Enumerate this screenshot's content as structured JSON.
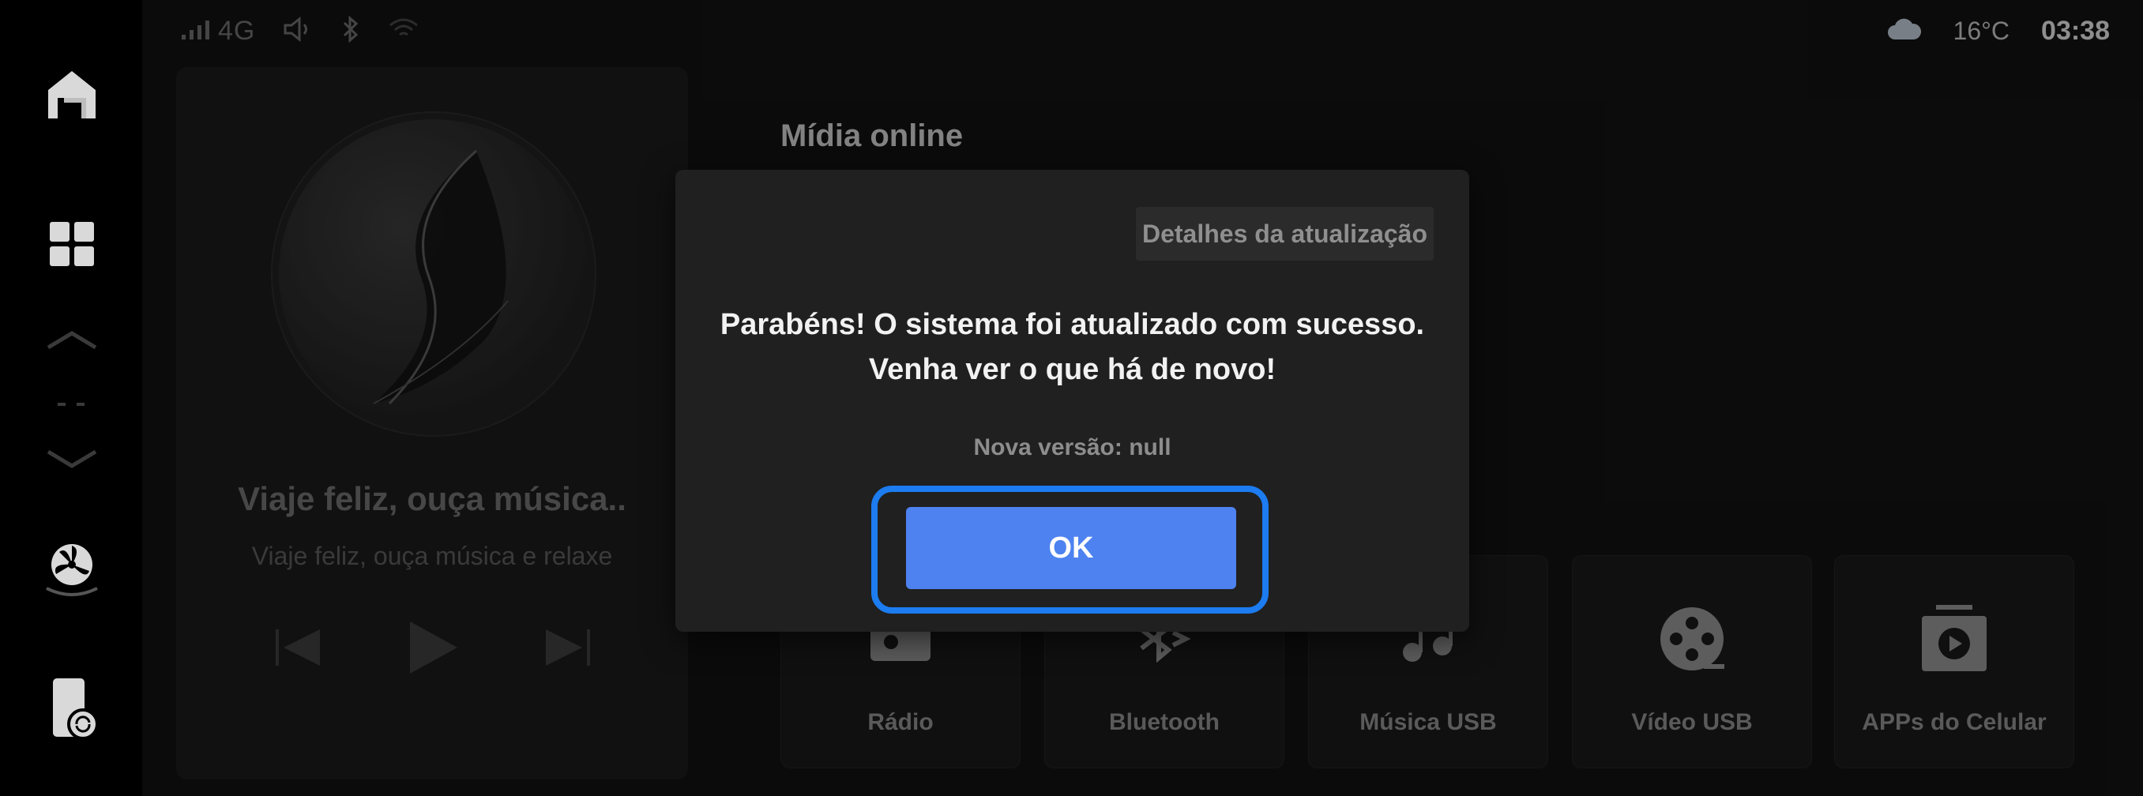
{
  "statusbar": {
    "network": "4G",
    "temperature": "16°C",
    "time": "03:38"
  },
  "sidebar": {
    "items": [
      {
        "icon": "home-icon"
      },
      {
        "icon": "apps-grid-icon"
      },
      {
        "icon": "fan-icon"
      },
      {
        "icon": "phone-sync-icon"
      }
    ]
  },
  "player": {
    "title": "Viaje feliz, ouça música..",
    "subtitle": "Viaje feliz, ouça música e relaxe"
  },
  "main": {
    "section_title": "Mídia online",
    "tiles": [
      {
        "label": "Rádio",
        "icon": "radio-icon"
      },
      {
        "label": "Bluetooth",
        "icon": "bluetooth-icon"
      },
      {
        "label": "Música USB",
        "icon": "music-icon"
      },
      {
        "label": "Vídeo USB",
        "icon": "film-reel-icon"
      },
      {
        "label": "APPs do Celular",
        "icon": "phone-apps-icon"
      }
    ]
  },
  "dialog": {
    "details_label": "Detalhes da atualização",
    "message_line1": "Parabéns! O sistema foi atualizado com sucesso.",
    "message_line2": "Venha ver o que há de novo!",
    "version": "Nova versão: null",
    "ok_label": "OK"
  },
  "colors": {
    "accent": "#4d82f0",
    "focus_ring": "#1c7cf0",
    "background": "#121212"
  }
}
